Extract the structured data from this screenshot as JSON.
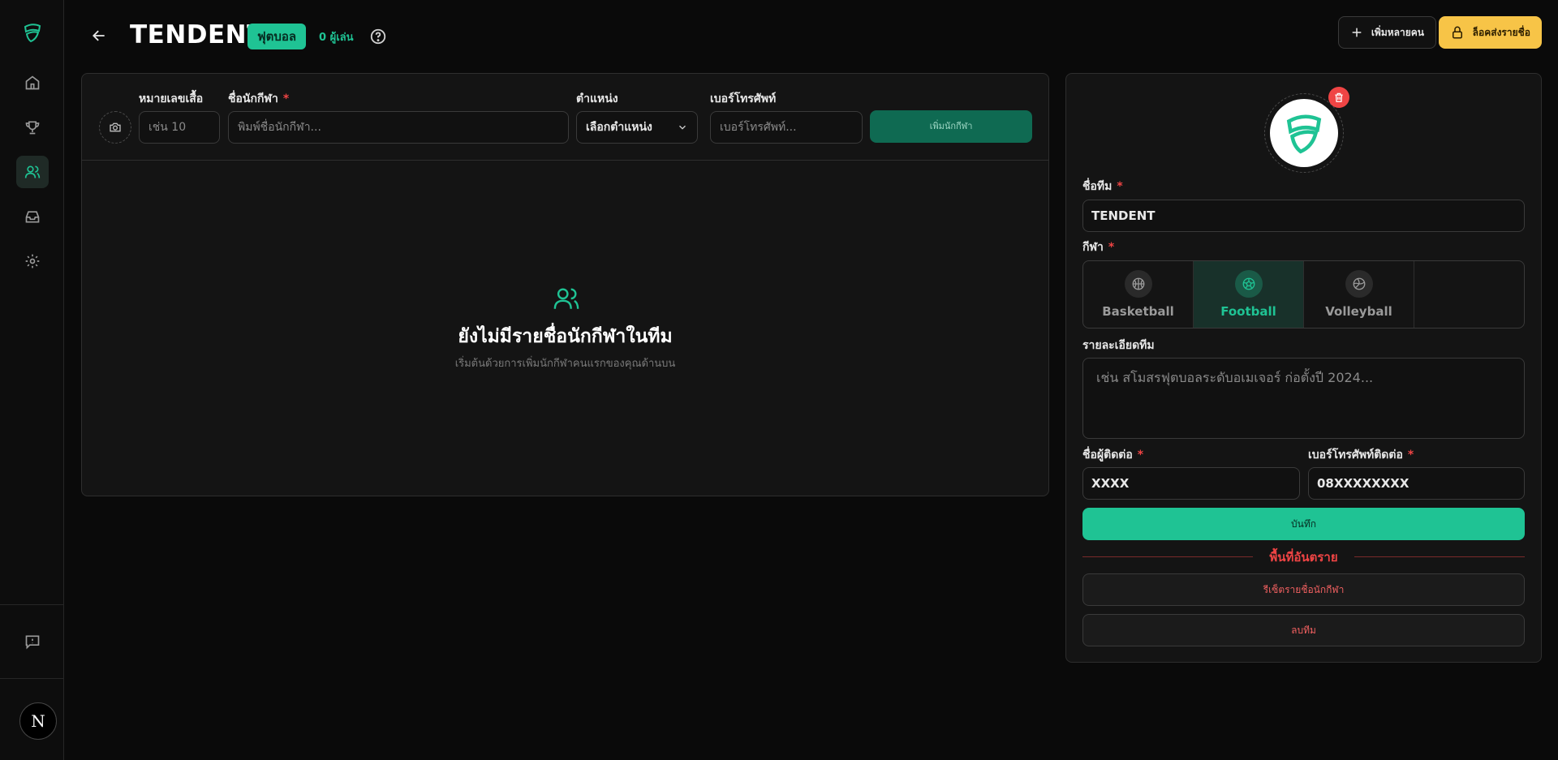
{
  "header": {
    "title": "TENDENT",
    "sport_badge": "ฟุตบอล",
    "player_count": "0 ผู้เล่น",
    "add_multiple_label": "เพิ่มหลายคน",
    "lock_roster_label": "ล็อคส่งรายชื่อ"
  },
  "player_form": {
    "jersey_label": "หมายเลขเสื้อ",
    "jersey_placeholder": "เช่น 10",
    "name_label": "ชื่อนักกีฬา",
    "name_placeholder": "พิมพ์ชื่อนักกีฬา...",
    "position_label": "ตำแหน่ง",
    "position_value": "เลือกตำแหน่ง",
    "phone_label": "เบอร์โทรศัพท์",
    "phone_placeholder": "เบอร์โทรศัพท์...",
    "add_button": "เพิ่มนักกีฬา",
    "required_mark": "*"
  },
  "empty_state": {
    "title": "ยังไม่มีรายชื่อนักกีฬาในทีม",
    "subtitle": "เริ่มต้นด้วยการเพิ่มนักกีฬาคนแรกของคุณด้านบน"
  },
  "team_form": {
    "team_name_label": "ชื่อทีม",
    "team_name_value": "TENDENT",
    "sport_label": "กีฬา",
    "sports": [
      {
        "label": "Basketball",
        "icon": "basketball-icon",
        "active": false
      },
      {
        "label": "Football",
        "icon": "football-icon",
        "active": true
      },
      {
        "label": "Volleyball",
        "icon": "volleyball-icon",
        "active": false
      }
    ],
    "details_label": "รายละเอียดทีม",
    "details_placeholder": "เช่น สโมสรฟุตบอลระดับอเมเจอร์ ก่อตั้งปี 2024...",
    "contact_name_label": "ชื่อผู้ติดต่อ",
    "contact_name_value": "XXXX",
    "contact_phone_label": "เบอร์โทรศัพท์ติดต่อ",
    "contact_phone_value": "08XXXXXXXX",
    "save_button": "บันทึก",
    "danger_zone_title": "พื้นที่อันตราย",
    "reset_roster_button": "รีเซ็ตรายชื่อนักกีฬา",
    "delete_team_button": "ลบทีม",
    "required_mark": "*"
  },
  "sidebar": {
    "avatar_letter": "N",
    "items": [
      "home-icon",
      "trophy-icon",
      "users-icon",
      "inbox-icon",
      "settings-icon",
      "feedback-icon"
    ]
  },
  "colors": {
    "accent": "#1fc394",
    "warning": "#f7c447",
    "danger": "#ef4444",
    "background": "#0a0a0a"
  }
}
